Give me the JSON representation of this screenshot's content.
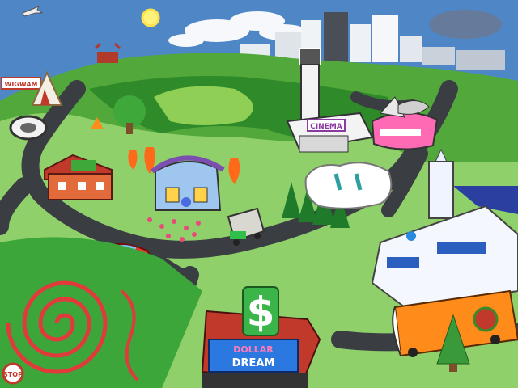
{
  "scene": {
    "signs": {
      "wigwam": "WIGWAM",
      "cinema": "CINEMA",
      "dollar_line1": "DOLLAR",
      "dollar_line2": "DREAM",
      "stop": "STOP",
      "dollar_symbol": "$"
    },
    "locations": [
      "wigwam-motel",
      "tire-shop",
      "red-farmhouse",
      "blue-cottage",
      "cinema",
      "pink-diner",
      "white-dome-building",
      "white-church",
      "orange-bus",
      "dollar-dream-store",
      "spiral-maze",
      "red-car",
      "gray-van"
    ],
    "colors": {
      "sky": "#4e86c8",
      "grass": "#8fd06a",
      "forest": "#2f8a2a",
      "road": "#3c3f43",
      "dollar_green": "#3bb54a",
      "cinema_white": "#f3f3f3",
      "diner_pink": "#ff69b4"
    }
  }
}
